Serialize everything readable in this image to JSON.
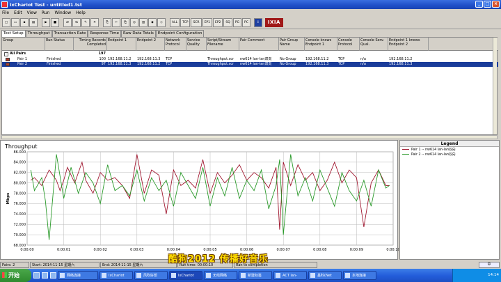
{
  "window": {
    "title": "IxChariot Test - untitled1.tst"
  },
  "menu": [
    "File",
    "Edit",
    "View",
    "Run",
    "Window",
    "Help"
  ],
  "toolbar": {
    "icons": [
      "new-icon",
      "open-icon",
      "save-icon",
      "print-icon",
      "run-icon",
      "stop-icon",
      "pair-icon",
      "pair-add-icon",
      "edit-icon",
      "delete-icon",
      "copy-icon",
      "cut-icon",
      "paste-icon",
      "mcast-icon",
      "graph-icon",
      "tb-icon-16",
      "tb-icon-17"
    ],
    "protocol_buttons": [
      "ALL",
      "TCP",
      "SCR",
      "EP1",
      "EP2",
      "SQ",
      "PG",
      "PC"
    ],
    "brand": "IXIA"
  },
  "tabs": [
    "Test Setup",
    "Throughput",
    "Transaction Rate",
    "Response Time",
    "Raw Data Totals",
    "Endpoint Configuration"
  ],
  "grid": {
    "columns": [
      "Group",
      "Run Status",
      "Timing Records Completed",
      "Endpoint 1",
      "Endpoint 2",
      "Network Protocol",
      "Service Quality",
      "Script/Stream Filename",
      "Pair Comment",
      "Pair Group Name",
      "Console knows Endpoint 1",
      "Console Protocol",
      "Console Serv. Qual.",
      "Endpoint 1 knows Endpoint 2"
    ],
    "group_row": {
      "label": "All Pairs",
      "timing": "197"
    },
    "rows": [
      {
        "group": "Pair 1",
        "status": "Finished",
        "timing": "100",
        "ep1": "192.168.11.2",
        "ep2": "192.168.11.3",
        "proto": "TCP",
        "sq": "",
        "script": "Throughput.scr",
        "comment": "nw614 lan-lan双向",
        "pgroup": "No Group",
        "cke1": "192.168.11.2",
        "cproto": "TCP",
        "csq": "n/a",
        "e1ke2": "192.168.11.2"
      },
      {
        "group": "Pair 2",
        "status": "Finished",
        "timing": "97",
        "ep1": "192.168.11.3",
        "ep2": "192.168.11.2",
        "proto": "TCP",
        "sq": "",
        "script": "Throughput.scr",
        "comment": "nw614 lan-lan双向",
        "pgroup": "No Group",
        "cke1": "192.168.11.3",
        "cproto": "TCP",
        "csq": "n/a",
        "e1ke2": "192.168.11.3"
      }
    ]
  },
  "chart_title": "Throughput",
  "chart_data": {
    "type": "line",
    "title": "Throughput",
    "ylabel": "Mbps",
    "xlabel": "",
    "ylim": [
      68,
      86
    ],
    "yticks": [
      "68.000",
      "70.000",
      "72.000",
      "74.000",
      "76.000",
      "78.000",
      "80.000",
      "82.000",
      "84.000",
      "86.000"
    ],
    "xticks": [
      "0:00:00",
      "0:00:01",
      "0:00:02",
      "0:00:03",
      "0:00:04",
      "0:00:05",
      "0:00:06",
      "0:00:07",
      "0:00:08",
      "0:00:09",
      "0:00:10"
    ],
    "xlim": [
      0,
      10
    ],
    "grid": true,
    "series": [
      {
        "name": "Pair 1 -- nw614 lan-lan双向",
        "color": "#a01830",
        "x": [
          0.1,
          0.2,
          0.4,
          0.6,
          0.8,
          0.9,
          1.0,
          1.1,
          1.3,
          1.5,
          1.6,
          1.8,
          2.0,
          2.2,
          2.4,
          2.6,
          2.8,
          3.0,
          3.2,
          3.4,
          3.6,
          3.8,
          4.0,
          4.2,
          4.4,
          4.6,
          4.8,
          5.0,
          5.2,
          5.4,
          5.6,
          5.8,
          6.0,
          6.2,
          6.4,
          6.6,
          6.8,
          6.9,
          7.0,
          7.2,
          7.4,
          7.6,
          7.8,
          8.0,
          8.2,
          8.4,
          8.6,
          8.8,
          9.0,
          9.2,
          9.4,
          9.6,
          9.8,
          9.9
        ],
        "y": [
          80.5,
          81.0,
          79.5,
          82.5,
          80.5,
          78.5,
          80.5,
          83.0,
          80.0,
          84.0,
          80.5,
          78.0,
          82.0,
          80.5,
          81.0,
          79.5,
          77.0,
          85.5,
          78.0,
          82.5,
          81.5,
          74.0,
          82.5,
          79.5,
          80.5,
          79.0,
          84.5,
          78.0,
          82.0,
          80.0,
          81.5,
          83.5,
          80.5,
          82.0,
          81.0,
          79.0,
          83.0,
          71.0,
          84.0,
          79.5,
          83.5,
          80.5,
          82.0,
          78.5,
          80.5,
          84.0,
          80.0,
          82.5,
          81.0,
          71.5,
          80.0,
          82.5,
          79.5,
          79.5
        ]
      },
      {
        "name": "Pair 2 -- nw614 lan-lan双向",
        "color": "#2a9a2a",
        "x": [
          0.1,
          0.2,
          0.4,
          0.5,
          0.6,
          0.8,
          1.0,
          1.2,
          1.4,
          1.6,
          1.8,
          2.0,
          2.2,
          2.4,
          2.6,
          2.8,
          3.0,
          3.2,
          3.4,
          3.6,
          3.8,
          4.0,
          4.2,
          4.4,
          4.6,
          4.8,
          5.0,
          5.2,
          5.4,
          5.6,
          5.8,
          6.0,
          6.2,
          6.4,
          6.6,
          6.8,
          6.9,
          7.0,
          7.2,
          7.4,
          7.6,
          7.8,
          8.0,
          8.2,
          8.4,
          8.6,
          8.8,
          9.0,
          9.2,
          9.4,
          9.6,
          9.8,
          9.9
        ],
        "y": [
          82.5,
          78.5,
          81.0,
          76.5,
          69.0,
          85.5,
          77.0,
          83.0,
          78.0,
          82.0,
          80.0,
          76.0,
          83.5,
          78.5,
          79.5,
          77.5,
          82.5,
          76.5,
          81.0,
          78.5,
          80.5,
          75.5,
          82.0,
          79.5,
          77.0,
          83.0,
          75.5,
          81.0,
          77.5,
          83.0,
          77.0,
          80.5,
          78.5,
          82.5,
          75.0,
          79.5,
          84.5,
          70.0,
          85.5,
          77.5,
          81.0,
          76.5,
          82.5,
          79.0,
          75.5,
          82.0,
          78.5,
          76.5,
          80.5,
          75.5,
          82.5,
          79.0,
          79.5
        ]
      }
    ]
  },
  "legend": {
    "title": "Legend"
  },
  "overlay_text": "酷狗2012 传播好音乐",
  "status": {
    "pairs": "Pairs: 2",
    "start": "Start: 2014-11-15 星期六",
    "end": "End: 2014-11-15 星期六",
    "run": "Run time: 00:00:10",
    "note": "Ran to completion"
  },
  "ime": "中",
  "taskbar": {
    "start": "开始",
    "tasks": [
      "网络连接",
      "IxChariot",
      "风吹好想",
      "IxChariot",
      "无线网络",
      "新建标签",
      "ACT lan-",
      "基科(Net",
      "本地连接"
    ],
    "clock": "14:14"
  }
}
